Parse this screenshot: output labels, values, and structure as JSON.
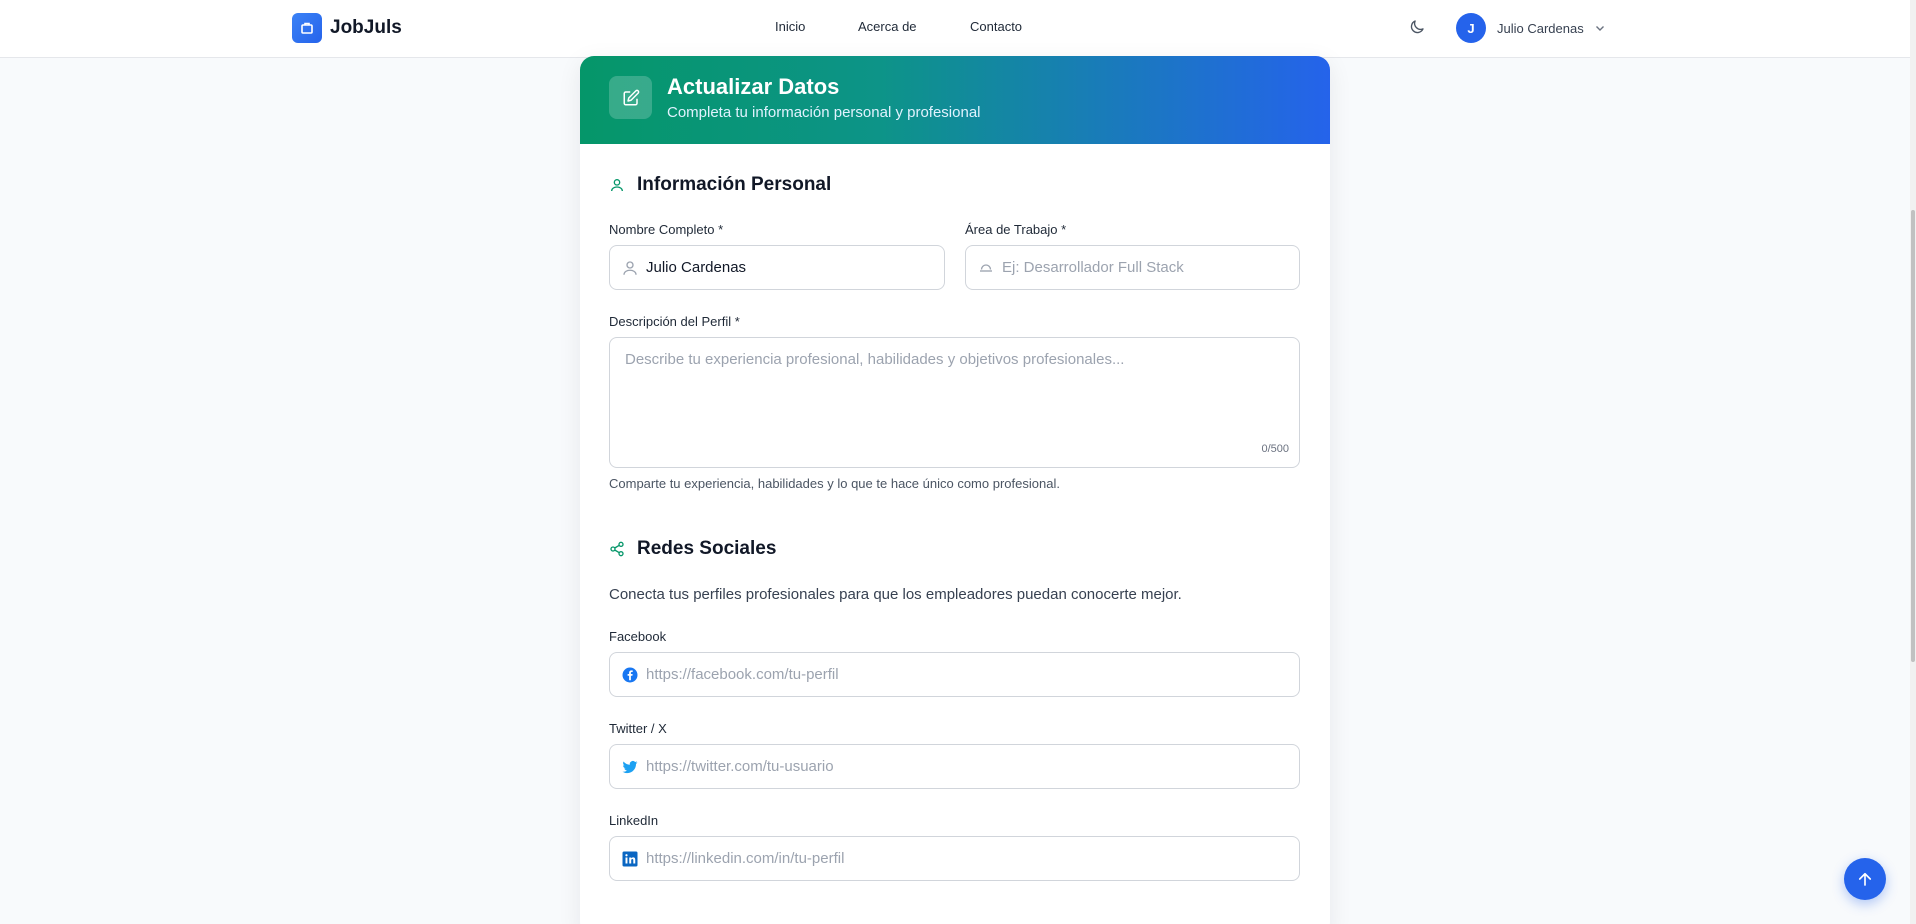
{
  "brand": {
    "name": "JobJuls"
  },
  "nav": {
    "items": [
      "Inicio",
      "Acerca de",
      "Contacto"
    ]
  },
  "user": {
    "initial": "J",
    "name": "Julio Cardenas"
  },
  "header": {
    "title": "Actualizar Datos",
    "subtitle": "Completa tu información personal y profesional"
  },
  "personal": {
    "title": "Información Personal",
    "name_label": "Nombre Completo *",
    "name_value": "Julio Cardenas",
    "area_label": "Área de Trabajo *",
    "area_placeholder": "Ej: Desarrollador Full Stack",
    "desc_label": "Descripción del Perfil *",
    "desc_placeholder": "Describe tu experiencia profesional, habilidades y objetivos profesionales...",
    "desc_count": "0/500",
    "desc_hint": "Comparte tu experiencia, habilidades y lo que te hace único como profesional."
  },
  "social": {
    "title": "Redes Sociales",
    "intro": "Conecta tus perfiles profesionales para que los empleadores puedan conocerte mejor.",
    "facebook_label": "Facebook",
    "facebook_placeholder": "https://facebook.com/tu-perfil",
    "twitter_label": "Twitter / X",
    "twitter_placeholder": "https://twitter.com/tu-usuario",
    "linkedin_label": "LinkedIn",
    "linkedin_placeholder": "https://linkedin.com/in/tu-perfil"
  },
  "colors": {
    "primary": "#2563eb",
    "accent": "#059669",
    "facebook": "#1877f2",
    "twitter": "#1da1f2",
    "linkedin": "#0a66c2"
  }
}
